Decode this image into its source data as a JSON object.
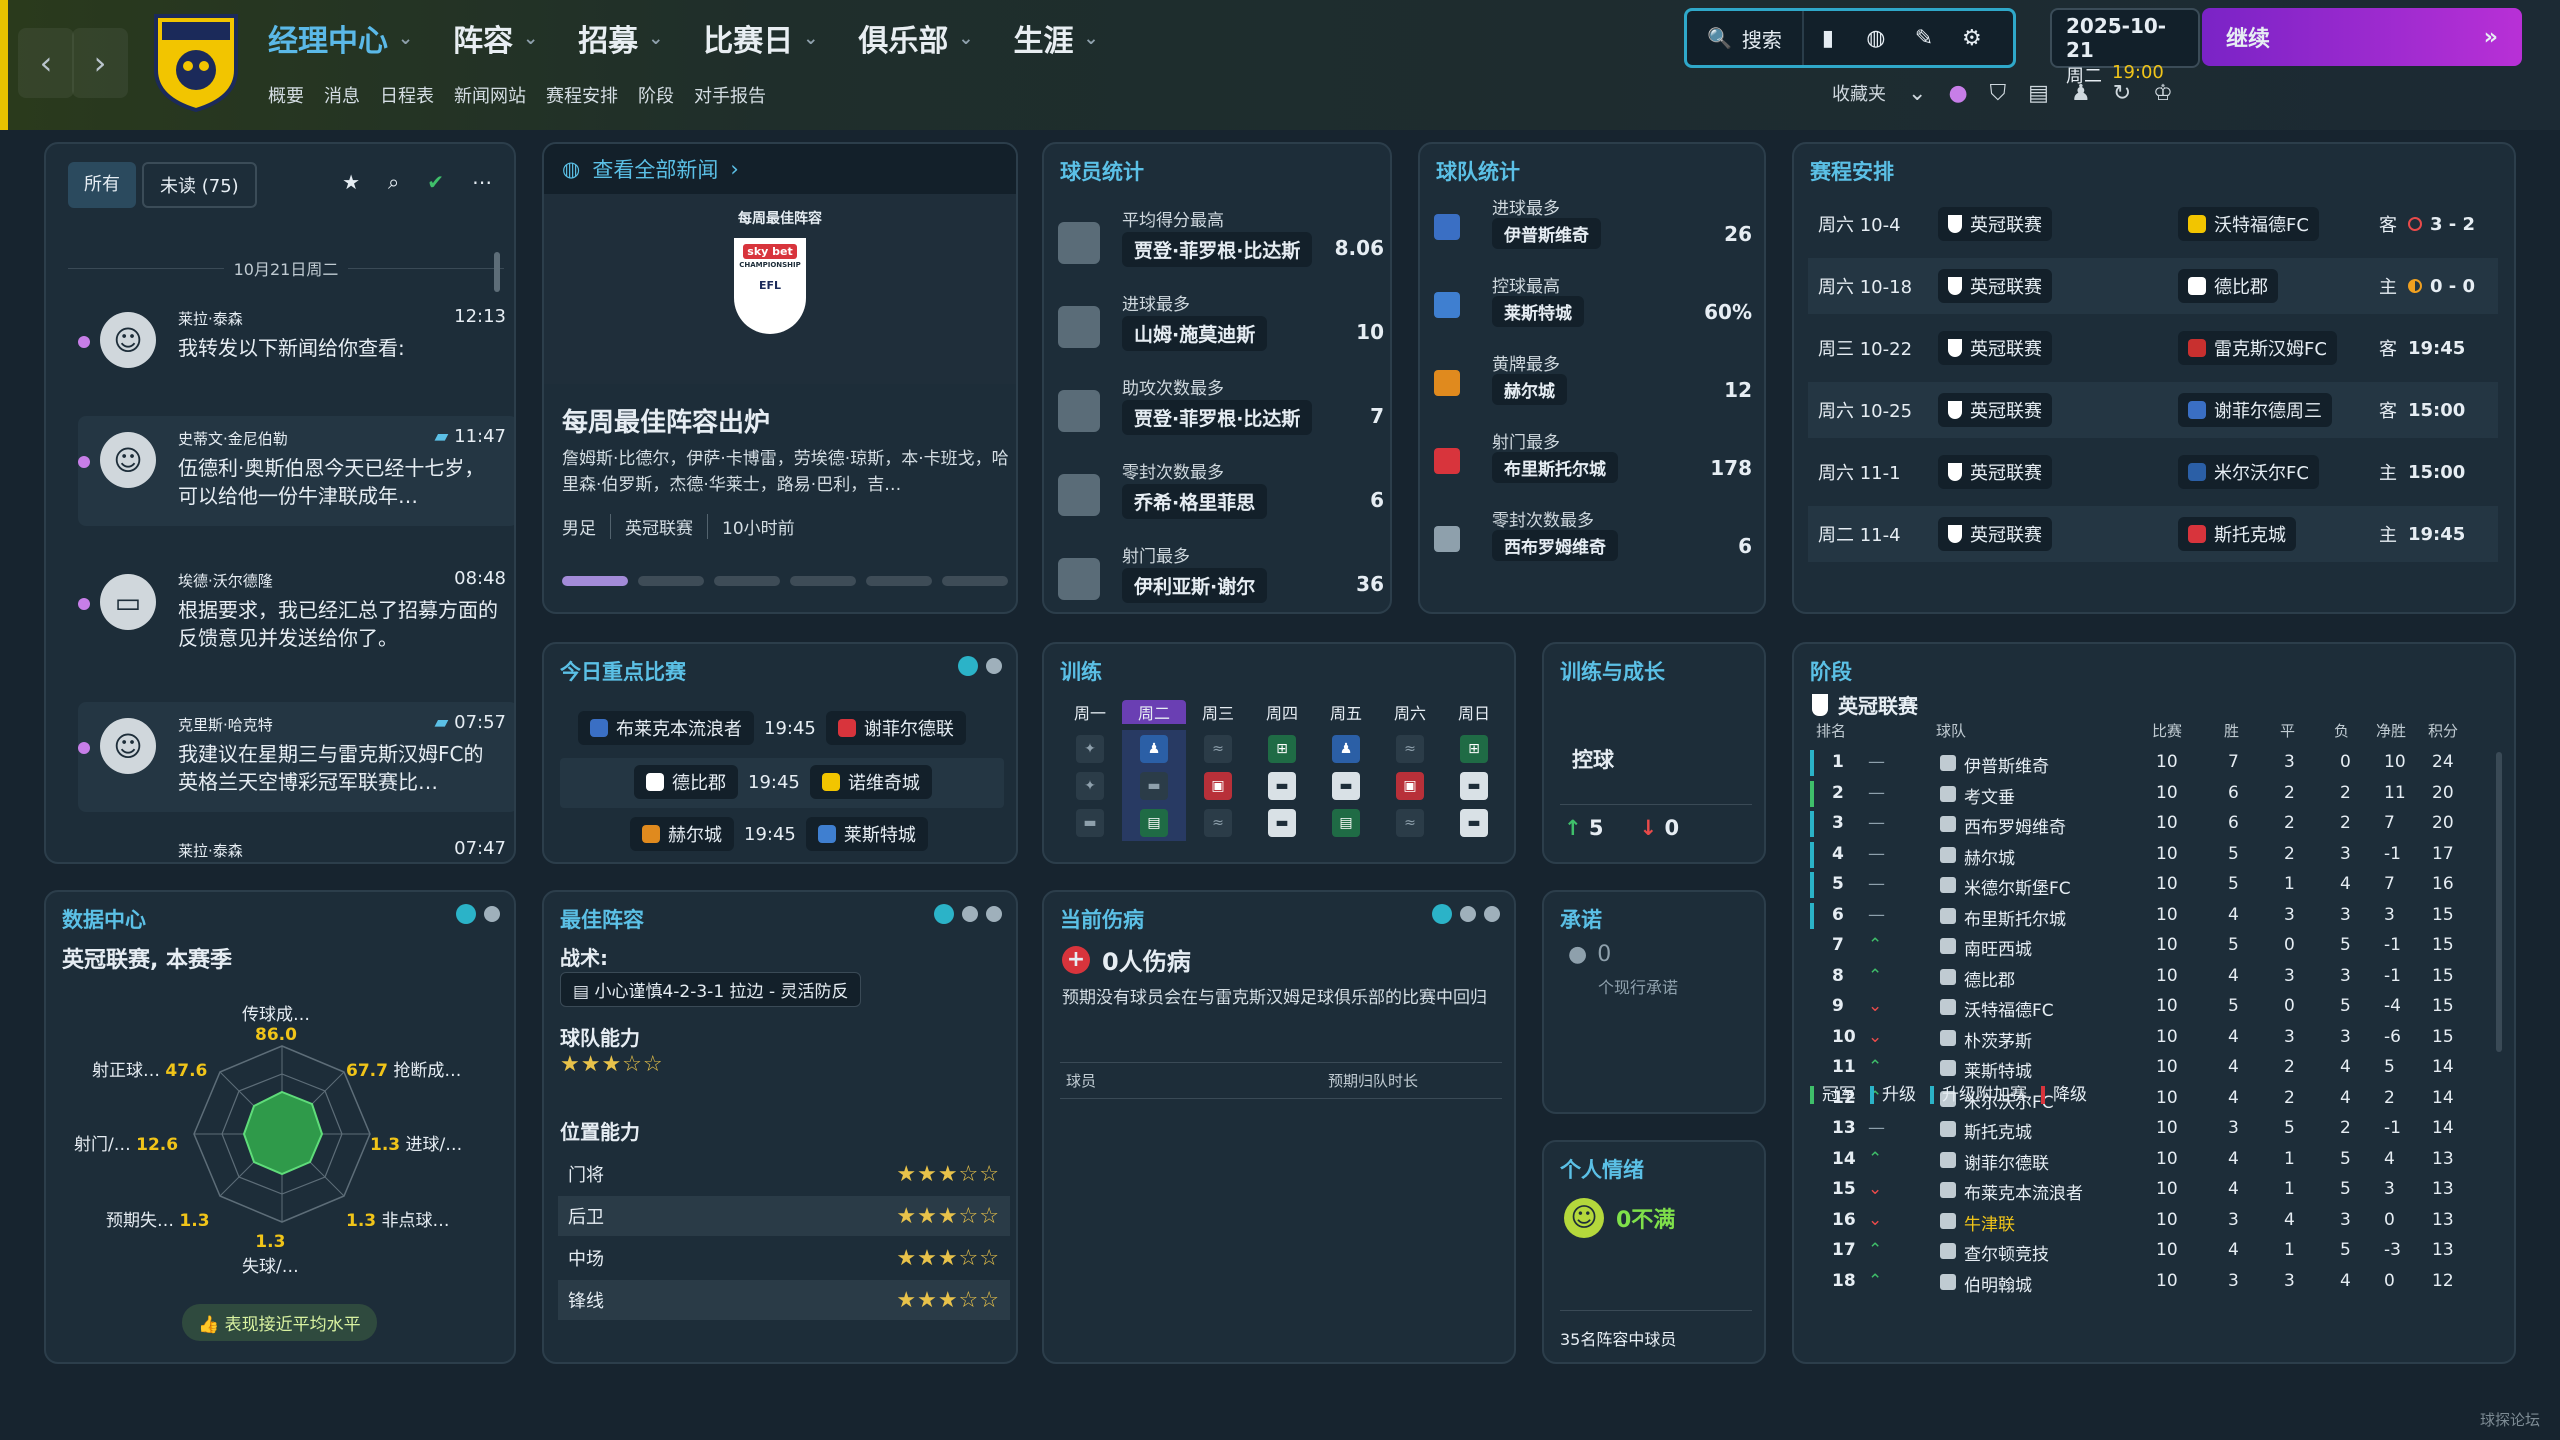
{
  "header": {
    "nav": [
      "经理中心",
      "阵容",
      "招募",
      "比赛日",
      "俱乐部",
      "生涯"
    ],
    "subnav": [
      "概要",
      "消息",
      "日程表",
      "新闻网站",
      "赛程安排",
      "阶段",
      "对手报告"
    ],
    "search_label": "搜索",
    "date": "2025-10-21",
    "weekday": "周二",
    "time": "19:00",
    "continue_label": "继续",
    "favorites_label": "收藏夹"
  },
  "inbox": {
    "tab_all": "所有",
    "tab_unread": "未读 (75)",
    "day": "10月21日周二",
    "messages": [
      {
        "from": "莱拉·泰森",
        "time": "12:13",
        "subject": "我转发以下新闻给你查看:"
      },
      {
        "from": "史蒂文·金尼伯勒",
        "time": "11:47",
        "subject": "伍德利·奥斯伯恩今天已经十七岁，可以给他一份牛津联成年…"
      },
      {
        "from": "埃德·沃尔德隆",
        "time": "08:48",
        "subject": "根据要求，我已经汇总了招募方面的反馈意见并发送给你了。"
      },
      {
        "from": "克里斯·哈克特",
        "time": "07:57",
        "subject": "我建议在星期三与雷克斯汉姆FC的英格兰天空博彩冠军联赛比…"
      },
      {
        "from": "莱拉·泰森",
        "time": "07:47",
        "subject": ""
      }
    ]
  },
  "news": {
    "header": "查看全部新闻",
    "badge_caption": "每周最佳阵容",
    "badge_brand": "sky bet",
    "badge_sub": "CHAMPIONSHIP",
    "badge_efl": "EFL",
    "title": "每周最佳阵容出炉",
    "body": "詹姆斯·比德尔，伊萨·卡博雷，劳埃德·琼斯，本·卡班戈，哈里森·伯罗斯，杰德·华莱士，路易·巴利，吉…",
    "meta": [
      "男足",
      "英冠联赛",
      "10小时前"
    ]
  },
  "player_stats": {
    "title": "球员统计",
    "rows": [
      {
        "label": "平均得分最高",
        "name": "贾登·菲罗根·比达斯",
        "value": "8.06"
      },
      {
        "label": "进球最多",
        "name": "山姆·施莫迪斯",
        "value": "10"
      },
      {
        "label": "助攻次数最多",
        "name": "贾登·菲罗根·比达斯",
        "value": "7"
      },
      {
        "label": "零封次数最多",
        "name": "乔希·格里菲思",
        "value": "6"
      },
      {
        "label": "射门最多",
        "name": "伊利亚斯·谢尔",
        "value": "36"
      }
    ]
  },
  "team_stats": {
    "title": "球队统计",
    "rows": [
      {
        "label": "进球最多",
        "name": "伊普斯维奇",
        "value": "26",
        "color": "#3a6fc4"
      },
      {
        "label": "控球最高",
        "name": "莱斯特城",
        "value": "60%",
        "color": "#3f7fd0"
      },
      {
        "label": "黄牌最多",
        "name": "赫尔城",
        "value": "12",
        "color": "#e08a1e"
      },
      {
        "label": "射门最多",
        "name": "布里斯托尔城",
        "value": "178",
        "color": "#d8343c"
      },
      {
        "label": "零封次数最多",
        "name": "西布罗姆维奇",
        "value": "6",
        "color": "#1e2f5a"
      }
    ]
  },
  "fixtures": {
    "title": "赛程安排",
    "rows": [
      {
        "date": "周六 10-4",
        "comp": "英冠联赛",
        "opp": "沃特福德FC",
        "ha": "客",
        "res": "3 - 2",
        "res_color": "#e84a4a"
      },
      {
        "date": "周六 10-18",
        "comp": "英冠联赛",
        "opp": "德比郡",
        "ha": "主",
        "res": "0 - 0",
        "res_color": "#f0a020"
      },
      {
        "date": "周三 10-22",
        "comp": "英冠联赛",
        "opp": "雷克斯汉姆FC",
        "ha": "客",
        "res": "19:45",
        "res_color": ""
      },
      {
        "date": "周六 10-25",
        "comp": "英冠联赛",
        "opp": "谢菲尔德周三",
        "ha": "客",
        "res": "15:00",
        "res_color": ""
      },
      {
        "date": "周六 11-1",
        "comp": "英冠联赛",
        "opp": "米尔沃尔FC",
        "ha": "主",
        "res": "15:00",
        "res_color": ""
      },
      {
        "date": "周二 11-4",
        "comp": "英冠联赛",
        "opp": "斯托克城",
        "ha": "主",
        "res": "19:45",
        "res_color": ""
      }
    ]
  },
  "key_matches": {
    "title": "今日重点比赛",
    "rows": [
      {
        "home": "布莱克本流浪者",
        "time": "19:45",
        "away": "谢菲尔德联"
      },
      {
        "home": "德比郡",
        "time": "19:45",
        "away": "诺维奇城"
      },
      {
        "home": "赫尔城",
        "time": "19:45",
        "away": "莱斯特城"
      }
    ]
  },
  "training": {
    "title": "训练",
    "days": [
      "周一",
      "周二",
      "周三",
      "周四",
      "周五",
      "周六",
      "周日"
    ]
  },
  "growth": {
    "title": "训练与成长",
    "focus": "控球",
    "up": "5",
    "down": "0"
  },
  "stage": {
    "title": "阶段",
    "league": "英冠联赛",
    "cols": [
      "排名",
      "球队",
      "比赛",
      "胜",
      "平",
      "负",
      "净胜",
      "积分"
    ],
    "rows": [
      {
        "pos": "1",
        "mv": "—",
        "team": "伊普斯维奇",
        "p": "10",
        "w": "7",
        "d": "3",
        "l": "0",
        "gd": "10",
        "pts": "24",
        "zone": "#2bb3c8"
      },
      {
        "pos": "2",
        "mv": "—",
        "team": "考文垂",
        "p": "10",
        "w": "6",
        "d": "2",
        "l": "2",
        "gd": "11",
        "pts": "20",
        "zone": "#3fbf6a"
      },
      {
        "pos": "3",
        "mv": "—",
        "team": "西布罗姆维奇",
        "p": "10",
        "w": "6",
        "d": "2",
        "l": "2",
        "gd": "7",
        "pts": "20",
        "zone": "#2bb3c8"
      },
      {
        "pos": "4",
        "mv": "—",
        "team": "赫尔城",
        "p": "10",
        "w": "5",
        "d": "2",
        "l": "3",
        "gd": "-1",
        "pts": "17",
        "zone": "#2bb3c8"
      },
      {
        "pos": "5",
        "mv": "—",
        "team": "米德尔斯堡FC",
        "p": "10",
        "w": "5",
        "d": "1",
        "l": "4",
        "gd": "7",
        "pts": "16",
        "zone": "#2bb3c8"
      },
      {
        "pos": "6",
        "mv": "—",
        "team": "布里斯托尔城",
        "p": "10",
        "w": "4",
        "d": "3",
        "l": "3",
        "gd": "3",
        "pts": "15",
        "zone": "#2bb3c8"
      },
      {
        "pos": "7",
        "mv": "^",
        "team": "南旺西城",
        "p": "10",
        "w": "5",
        "d": "0",
        "l": "5",
        "gd": "-1",
        "pts": "15",
        "zone": ""
      },
      {
        "pos": "8",
        "mv": "^",
        "team": "德比郡",
        "p": "10",
        "w": "4",
        "d": "3",
        "l": "3",
        "gd": "-1",
        "pts": "15",
        "zone": ""
      },
      {
        "pos": "9",
        "mv": "v",
        "team": "沃特福德FC",
        "p": "10",
        "w": "5",
        "d": "0",
        "l": "5",
        "gd": "-4",
        "pts": "15",
        "zone": ""
      },
      {
        "pos": "10",
        "mv": "v",
        "team": "朴茨茅斯",
        "p": "10",
        "w": "4",
        "d": "3",
        "l": "3",
        "gd": "-6",
        "pts": "15",
        "zone": ""
      },
      {
        "pos": "11",
        "mv": "^",
        "team": "莱斯特城",
        "p": "10",
        "w": "4",
        "d": "2",
        "l": "4",
        "gd": "5",
        "pts": "14",
        "zone": ""
      },
      {
        "pos": "12",
        "mv": "^",
        "team": "米尔沃尔FC",
        "p": "10",
        "w": "4",
        "d": "2",
        "l": "4",
        "gd": "2",
        "pts": "14",
        "zone": ""
      },
      {
        "pos": "13",
        "mv": "—",
        "team": "斯托克城",
        "p": "10",
        "w": "3",
        "d": "5",
        "l": "2",
        "gd": "-1",
        "pts": "14",
        "zone": ""
      },
      {
        "pos": "14",
        "mv": "^",
        "team": "谢菲尔德联",
        "p": "10",
        "w": "4",
        "d": "1",
        "l": "5",
        "gd": "4",
        "pts": "13",
        "zone": ""
      },
      {
        "pos": "15",
        "mv": "v",
        "team": "布莱克本流浪者",
        "p": "10",
        "w": "4",
        "d": "1",
        "l": "5",
        "gd": "3",
        "pts": "13",
        "zone": ""
      },
      {
        "pos": "16",
        "mv": "v",
        "team": "牛津联",
        "p": "10",
        "w": "3",
        "d": "4",
        "l": "3",
        "gd": "0",
        "pts": "13",
        "zone": "",
        "highlight": true
      },
      {
        "pos": "17",
        "mv": "^",
        "team": "查尔顿竞技",
        "p": "10",
        "w": "4",
        "d": "1",
        "l": "5",
        "gd": "-3",
        "pts": "13",
        "zone": ""
      },
      {
        "pos": "18",
        "mv": "^",
        "team": "伯明翰城",
        "p": "10",
        "w": "3",
        "d": "3",
        "l": "4",
        "gd": "0",
        "pts": "12",
        "zone": ""
      }
    ],
    "legend": [
      "冠军",
      "升级",
      "升级附加赛",
      "降级"
    ],
    "legend_colors": [
      "#3fbf6a",
      "#2bb3c8",
      "#2bb3c8",
      "#d8343c"
    ]
  },
  "data_hub": {
    "title": "数据中心",
    "subtitle": "英冠联赛, 本赛季",
    "labels": [
      {
        "text": "传球成…",
        "value": "86.0"
      },
      {
        "text": "抢断成…",
        "value": "67.7"
      },
      {
        "text": "进球/…",
        "value": "1.3"
      },
      {
        "text": "非点球…",
        "value": "1.3"
      },
      {
        "text": "失球/…",
        "value": "1.3"
      },
      {
        "text": "预期失…",
        "value": "1.3"
      },
      {
        "text": "射门/…",
        "value": "12.6"
      },
      {
        "text": "射正球…",
        "value": "47.6"
      }
    ],
    "avg_label": "表现接近平均水平"
  },
  "best_xi": {
    "title": "最佳阵容",
    "tactic_label": "战术:",
    "tactic": "小心谨慎4-2-3-1 拉边 - 灵活防反",
    "team_ability_label": "球队能力",
    "team_stars": "★★★☆☆",
    "positions_label": "位置能力",
    "positions": [
      {
        "name": "门将",
        "stars": "★★★☆☆"
      },
      {
        "name": "后卫",
        "stars": "★★★☆☆"
      },
      {
        "name": "中场",
        "stars": "★★★☆☆"
      },
      {
        "name": "锋线",
        "stars": "★★★☆☆"
      }
    ]
  },
  "injuries": {
    "title": "当前伤病",
    "count": "0人伤病",
    "desc": "预期没有球员会在与雷克斯汉姆足球俱乐部的比赛中回归",
    "col_player": "球员",
    "col_return": "预期归队时长"
  },
  "promises": {
    "title": "承诺",
    "count": "0",
    "desc": "个现行承诺"
  },
  "mood": {
    "title": "个人情绪",
    "value": "0不满",
    "footer": "35名阵容中球员"
  },
  "watermark": "球探论坛"
}
